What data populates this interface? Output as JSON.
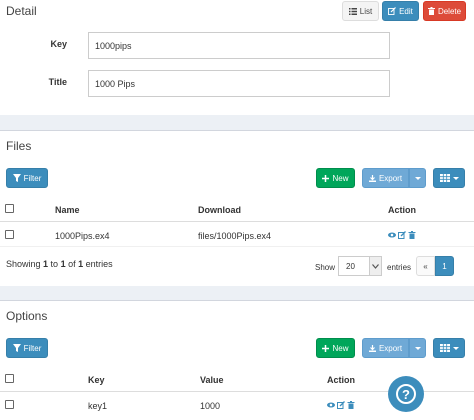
{
  "detail": {
    "title": "Detail",
    "list_label": "List",
    "edit_label": "Edit",
    "delete_label": "Delete",
    "fields": [
      {
        "label": "Key",
        "value": "1000pips"
      },
      {
        "label": "Title",
        "value": "1000 Pips"
      }
    ]
  },
  "files": {
    "title": "Files",
    "filter_label": "Filter",
    "new_label": "New",
    "export_label": "Export",
    "columns": [
      "Name",
      "Download",
      "Action"
    ],
    "rows": [
      {
        "name": "1000Pips.ex4",
        "download": "files/1000Pips.ex4"
      }
    ],
    "showing_prefix": "Showing ",
    "showing_from": "1",
    "showing_to_word": " to ",
    "showing_to": "1",
    "showing_of_word": " of ",
    "showing_total": "1",
    "showing_suffix": " entries",
    "show_label": "Show",
    "page_size": "20",
    "entries_label": "entries",
    "prev_label": "«",
    "current_page": "1"
  },
  "options": {
    "title": "Options",
    "filter_label": "Filter",
    "new_label": "New",
    "export_label": "Export",
    "columns": [
      "Key",
      "Value",
      "Action"
    ],
    "rows": [
      {
        "key": "key1",
        "value": "1000"
      }
    ]
  },
  "help": {
    "glyph": "?"
  }
}
